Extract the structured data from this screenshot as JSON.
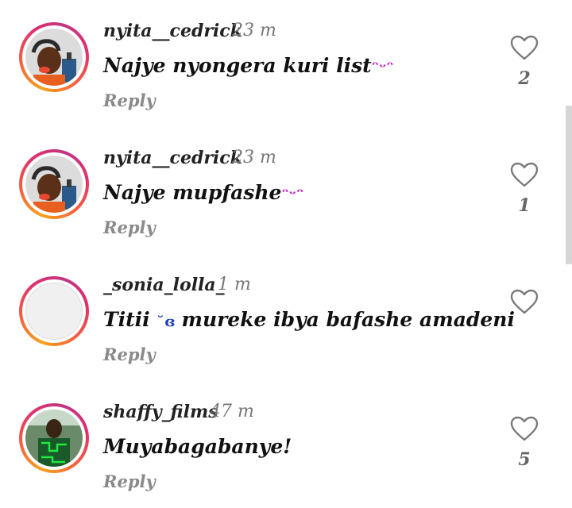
{
  "colors": {
    "username": "#222222",
    "time": "#777777",
    "reply": "#8a8a8a",
    "likes": "#666666",
    "heart_outline": "#7a7a7a",
    "scrollbar": "#d6d6d6"
  },
  "comments": [
    {
      "username": "nyita__cedrick",
      "time": "23 m",
      "text": "Najye nyongera kuri list",
      "emoji": "💋",
      "reply_label": "Reply",
      "likes": "2",
      "avatar": "photo-man-headphones"
    },
    {
      "username": "nyita__cedrick",
      "time": "23 m",
      "text": "Najye mupfashe",
      "emoji": "💋",
      "reply_label": "Reply",
      "likes": "1",
      "avatar": "photo-man-headphones"
    },
    {
      "username": "_sonia_lolla_",
      "time": "1 m",
      "text_before": "Titii",
      "emoji": "🥲",
      "text_after": "mureke ibya bafashe amadeni",
      "reply_label": "Reply",
      "likes": "",
      "avatar": "empty-avatar"
    },
    {
      "username": "shaffy_films",
      "time": "47 m",
      "text": "Muyabagabanye!",
      "reply_label": "Reply",
      "likes": "5",
      "avatar": "photo-man-green-shirt"
    }
  ]
}
